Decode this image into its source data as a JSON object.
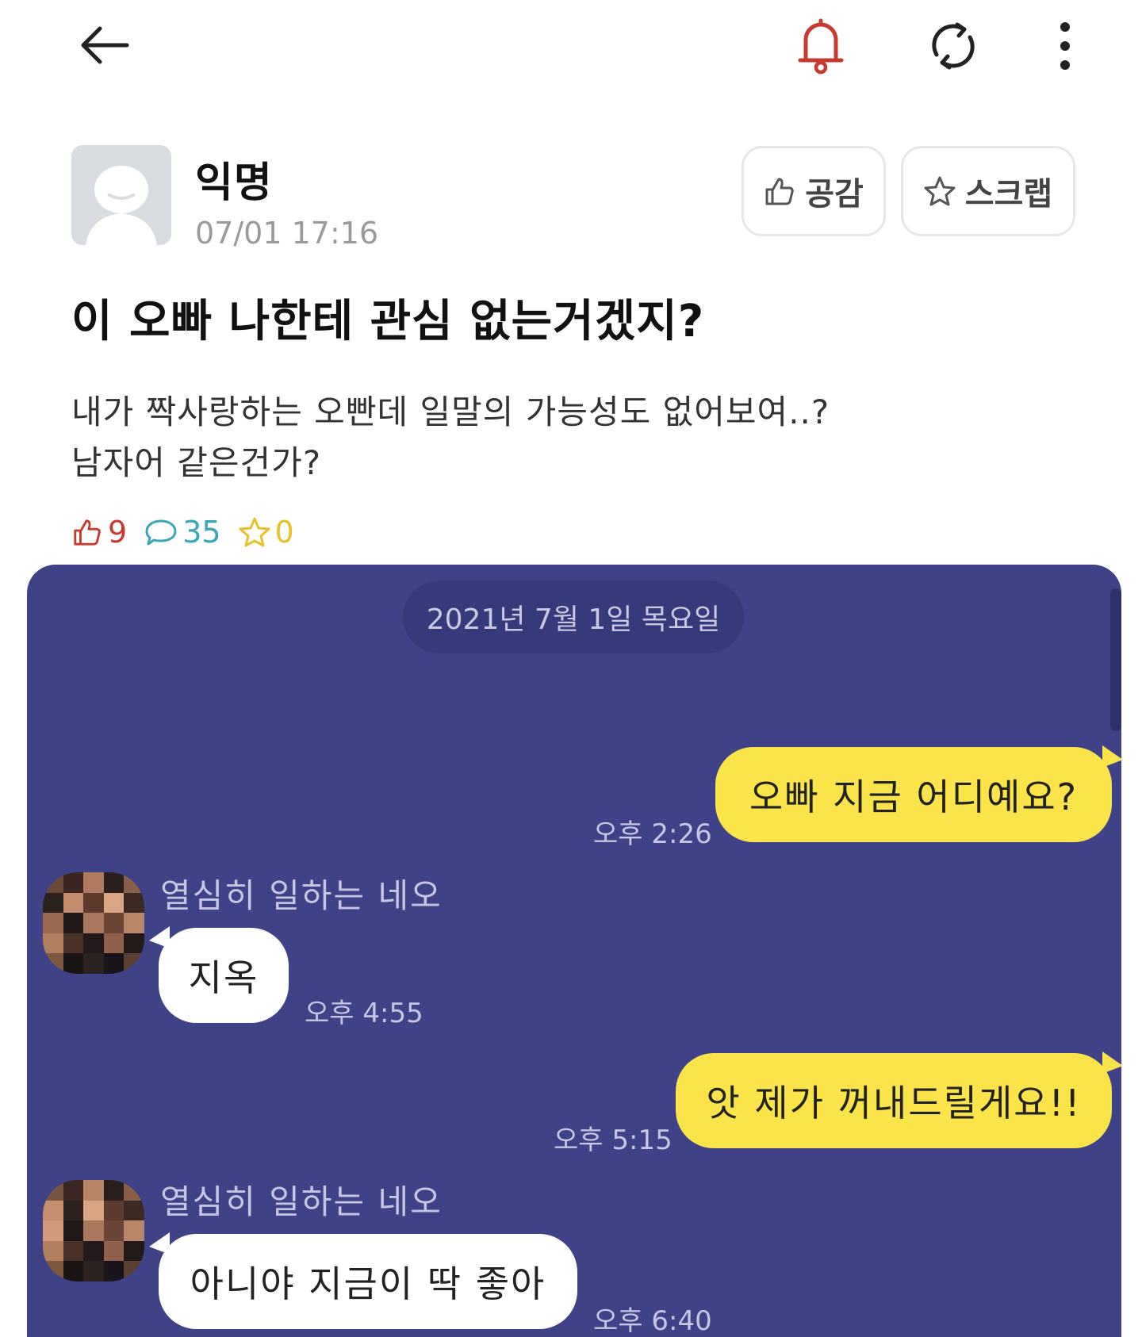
{
  "topbar": {
    "icons": [
      "back-arrow-icon",
      "bell-icon",
      "refresh-icon",
      "more-vertical-icon"
    ],
    "bell_color": "#c8392f"
  },
  "post": {
    "author": "익명",
    "timestamp": "07/01 17:16",
    "like_button_label": "공감",
    "scrap_button_label": "스크랩",
    "title": "이 오빠 나한테 관심 없는거겠지?",
    "body_lines": [
      "내가 짝사랑하는 오빤데 일말의 가능성도 없어보여..?",
      "남자어 같은건가?"
    ],
    "stats": {
      "likes": "9",
      "comments": "35",
      "scraps": "0"
    }
  },
  "chat": {
    "date": "2021년 7월 1일 목요일",
    "messages": [
      {
        "direction": "out",
        "text": "오빠 지금 어디예요?",
        "time": "오후 2:26"
      },
      {
        "direction": "in",
        "sender": "열심히 일하는 네오",
        "text": "지옥",
        "time": "오후 4:55"
      },
      {
        "direction": "out",
        "text": "앗 제가 꺼내드릴게요!!",
        "time": "오후 5:15"
      },
      {
        "direction": "in",
        "sender": "열심히 일하는 네오",
        "text": "아니야 지금이 딱 좋아",
        "time": "오후 6:40"
      }
    ],
    "colors": {
      "background": "#3f4286",
      "outgoing_bubble": "#fbe34a",
      "incoming_bubble": "#ffffff"
    }
  }
}
